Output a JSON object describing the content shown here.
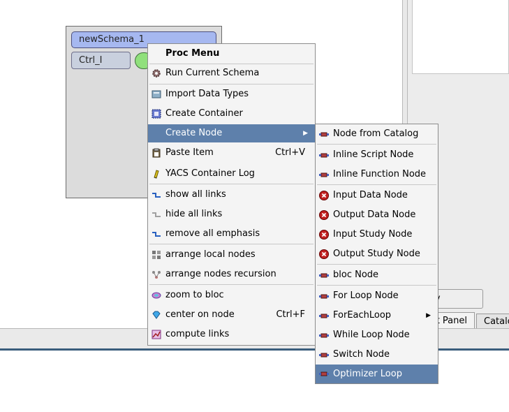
{
  "schema_node": {
    "title": "newSchema_1",
    "control_label": "Ctrl_I"
  },
  "background": {
    "apply_button": "ply",
    "tab_panel": "t Panel",
    "tab_catalog": "Catalo"
  },
  "proc_menu": {
    "title": "Proc Menu",
    "items": [
      {
        "label": "Run Current Schema",
        "icon": "gear-icon"
      },
      {
        "label": "Import Data Types",
        "icon": "import-icon"
      },
      {
        "label": "Create Container",
        "icon": "container-icon"
      },
      {
        "label": "Create Node",
        "icon": "none",
        "submenu": true,
        "highlighted": true
      },
      {
        "label": "Paste Item",
        "shortcut": "Ctrl+V",
        "icon": "paste-icon"
      },
      {
        "label": "YACS Container Log",
        "icon": "log-icon"
      },
      {
        "label": "show all links",
        "icon": "link-icon"
      },
      {
        "label": "hide all links",
        "icon": "link-hidden-icon"
      },
      {
        "label": "remove all emphasis",
        "icon": "link-icon"
      },
      {
        "label": "arrange local nodes",
        "icon": "arrange-icon"
      },
      {
        "label": "arrange nodes recursion",
        "icon": "arrange-recursive-icon"
      },
      {
        "label": "zoom to bloc",
        "icon": "zoom-icon"
      },
      {
        "label": "center on node",
        "shortcut": "Ctrl+F",
        "icon": "diamond-icon"
      },
      {
        "label": "compute links",
        "icon": "compute-icon"
      }
    ]
  },
  "node_menu": {
    "items": [
      {
        "label": "Node from Catalog",
        "icon": "node-icon"
      },
      {
        "label": "Inline Script Node",
        "icon": "node-icon"
      },
      {
        "label": "Inline Function Node",
        "icon": "node-icon"
      },
      {
        "label": "Input Data Node",
        "icon": "error-icon"
      },
      {
        "label": "Output Data Node",
        "icon": "error-icon"
      },
      {
        "label": "Input Study Node",
        "icon": "error-icon"
      },
      {
        "label": "Output Study Node",
        "icon": "error-icon"
      },
      {
        "label": "bloc Node",
        "icon": "node-icon"
      },
      {
        "label": "For Loop Node",
        "icon": "node-icon"
      },
      {
        "label": "ForEachLoop",
        "icon": "node-icon",
        "submenu": true
      },
      {
        "label": "While Loop Node",
        "icon": "node-icon"
      },
      {
        "label": "Switch Node",
        "icon": "node-icon"
      },
      {
        "label": "Optimizer Loop",
        "icon": "node-icon",
        "highlighted": true
      }
    ]
  },
  "colors": {
    "highlight": "#5e80ab",
    "schema_title_bg": "#a6b8f0",
    "port_green": "#90e07c"
  }
}
